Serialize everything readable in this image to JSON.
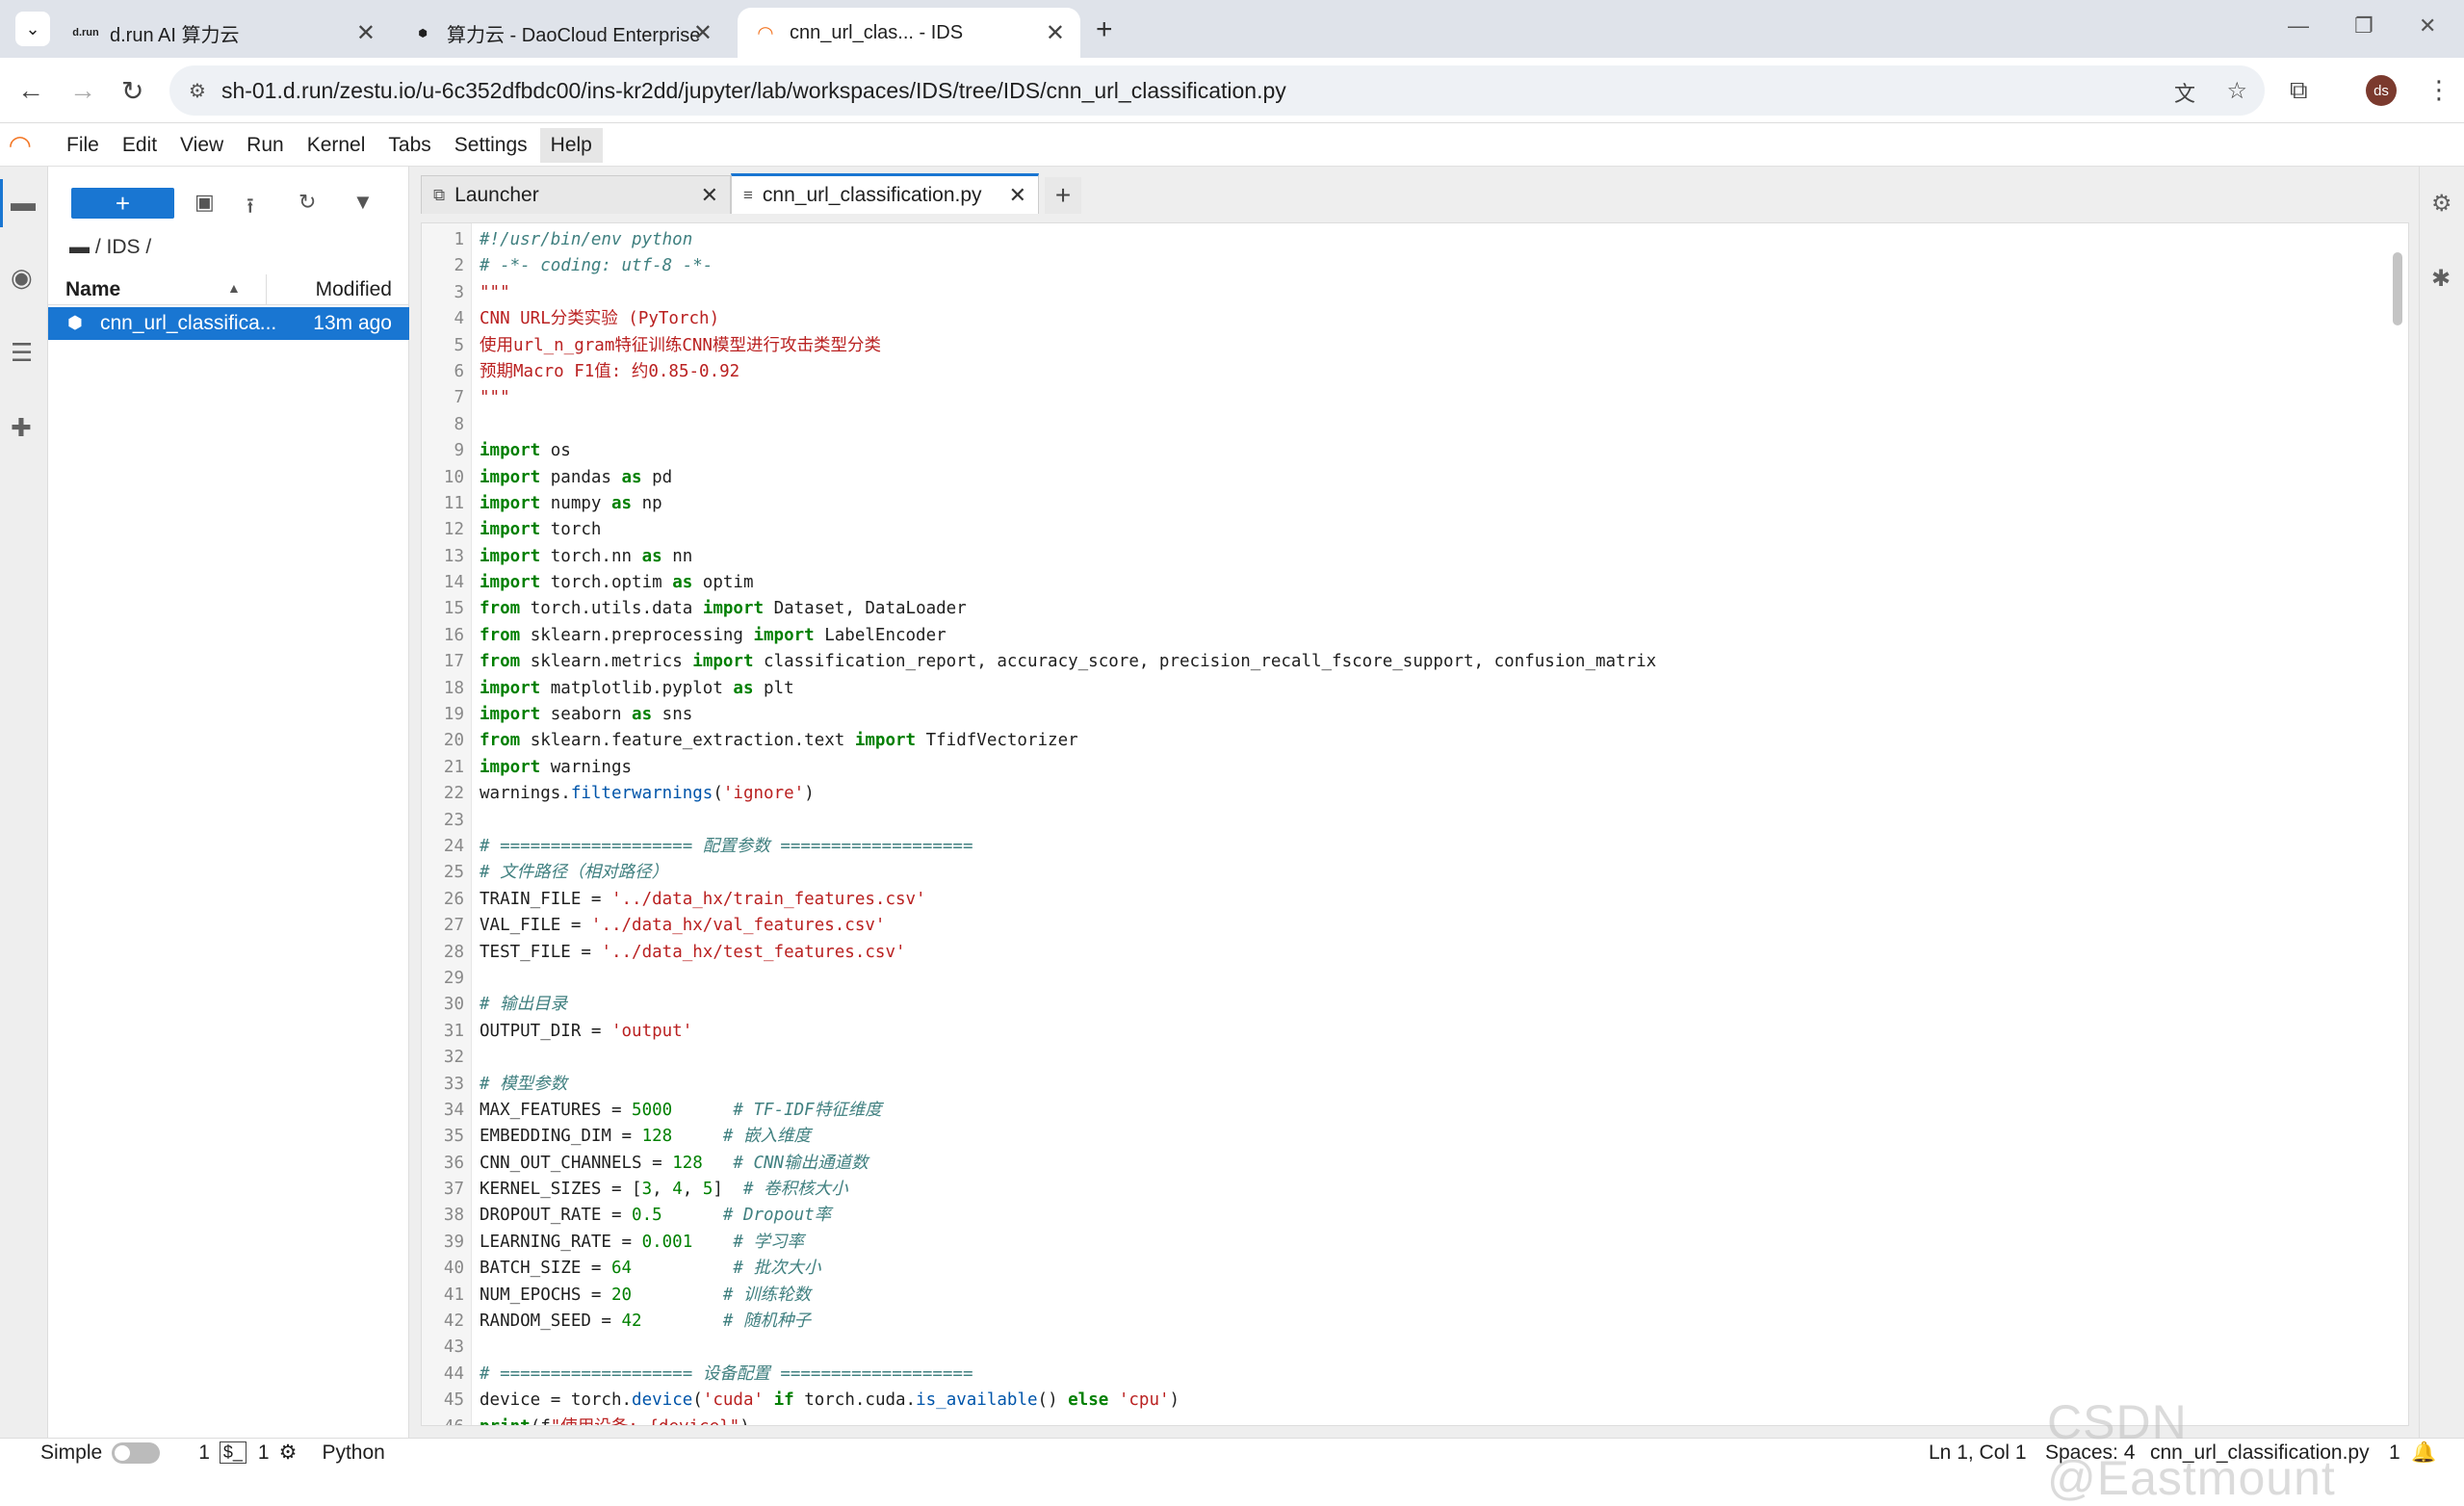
{
  "browser": {
    "tabs": [
      {
        "label": "d.run AI 算力云",
        "favicon": "d.run"
      },
      {
        "label": "算力云 - DaoCloud Enterprise",
        "favicon": "⬢"
      },
      {
        "label": "cnn_url_clas... - IDS",
        "favicon": "jupyter"
      }
    ],
    "url": "sh-01.d.run/zestu.io/u-6c352dfbdc00/ins-kr2dd/jupyter/lab/workspaces/IDS/tree/IDS/cnn_url_classification.py",
    "avatar": "ds"
  },
  "menu": [
    "File",
    "Edit",
    "View",
    "Run",
    "Kernel",
    "Tabs",
    "Settings",
    "Help"
  ],
  "filebrowser": {
    "breadcrumb": "/ IDS /",
    "col_name": "Name",
    "col_modified": "Modified",
    "files": [
      {
        "name": "cnn_url_classifica...",
        "modified": "13m ago"
      }
    ]
  },
  "doctabs": [
    {
      "label": "Launcher"
    },
    {
      "label": "cnn_url_classification.py"
    }
  ],
  "code_lines": [
    "#!/usr/bin/env python",
    "# -*- coding: utf-8 -*-",
    "\"\"\"",
    "CNN URL分类实验 (PyTorch)",
    "使用url_n_gram特征训练CNN模型进行攻击类型分类",
    "预期Macro F1值: 约0.85-0.92",
    "\"\"\"",
    "",
    "import os",
    "import pandas as pd",
    "import numpy as np",
    "import torch",
    "import torch.nn as nn",
    "import torch.optim as optim",
    "from torch.utils.data import Dataset, DataLoader",
    "from sklearn.preprocessing import LabelEncoder",
    "from sklearn.metrics import classification_report, accuracy_score, precision_recall_fscore_support, confusion_matrix",
    "import matplotlib.pyplot as plt",
    "import seaborn as sns",
    "from sklearn.feature_extraction.text import TfidfVectorizer",
    "import warnings",
    "warnings.filterwarnings('ignore')",
    "",
    "# =================== 配置参数 ===================",
    "# 文件路径（相对路径）",
    "TRAIN_FILE = '../data_hx/train_features.csv'",
    "VAL_FILE = '../data_hx/val_features.csv'",
    "TEST_FILE = '../data_hx/test_features.csv'",
    "",
    "# 输出目录",
    "OUTPUT_DIR = 'output'",
    "",
    "# 模型参数",
    "MAX_FEATURES = 5000      # TF-IDF特征维度",
    "EMBEDDING_DIM = 128     # 嵌入维度",
    "CNN_OUT_CHANNELS = 128   # CNN输出通道数",
    "KERNEL_SIZES = [3, 4, 5]  # 卷积核大小",
    "DROPOUT_RATE = 0.5      # Dropout率",
    "LEARNING_RATE = 0.001    # 学习率",
    "BATCH_SIZE = 64          # 批次大小",
    "NUM_EPOCHS = 20         # 训练轮数",
    "RANDOM_SEED = 42        # 随机种子",
    "",
    "# =================== 设备配置 ===================",
    "device = torch.device('cuda' if torch.cuda.is_available() else 'cpu')",
    "print(f\"使用设备: {device}\")"
  ],
  "status": {
    "mode": "Simple",
    "terminals": "1",
    "kernels": "1",
    "language": "Python",
    "cursor": "Ln 1, Col 1",
    "spaces": "Spaces: 4",
    "filename": "cnn_url_classification.py",
    "notifications": "1"
  },
  "watermark": "CSDN @Eastmount"
}
